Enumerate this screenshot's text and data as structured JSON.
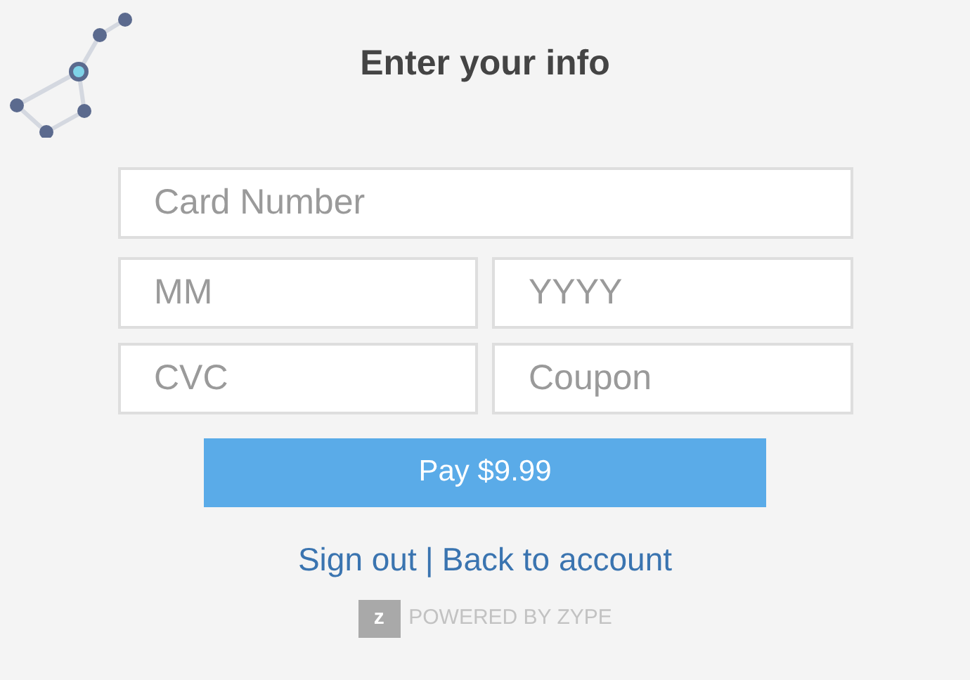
{
  "title": "Enter your info",
  "fields": [
    {
      "placeholder": "Card Number"
    },
    {
      "placeholder": "MM"
    },
    {
      "placeholder": "YYYY"
    },
    {
      "placeholder": "CVC"
    },
    {
      "placeholder": "Coupon"
    }
  ],
  "pay_button": "Pay $9.99",
  "links": [
    {
      "label": "Sign out"
    },
    {
      "label": "Back to account"
    }
  ],
  "separator": "|",
  "footer": {
    "logo_letter": "z",
    "text": "POWERED BY ZYPE"
  }
}
